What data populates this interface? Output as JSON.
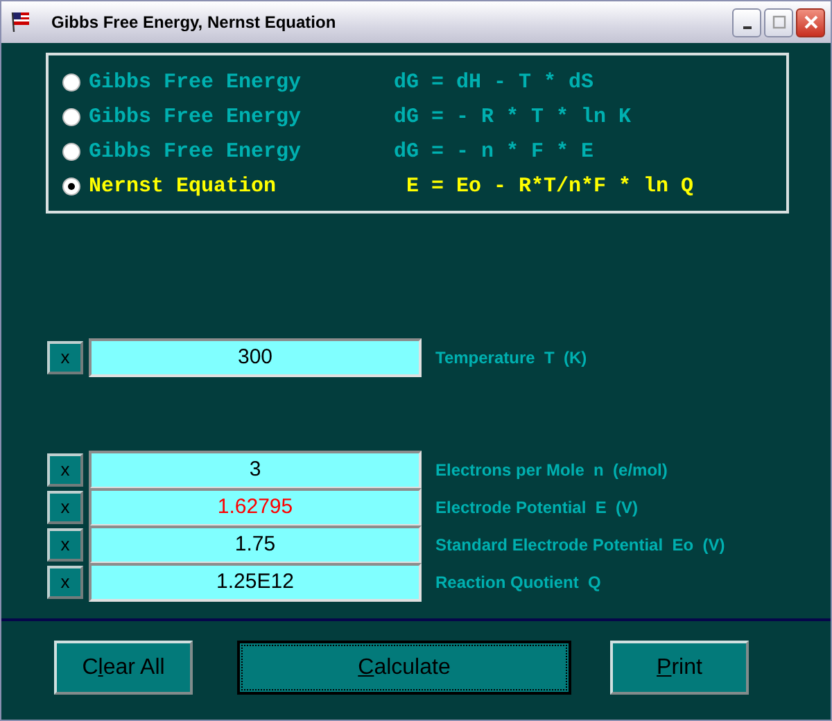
{
  "window": {
    "title": "Gibbs Free Energy, Nernst Equation"
  },
  "options": [
    {
      "label": "Gibbs Free Energy",
      "equation": "dG = dH - T * dS",
      "selected": false
    },
    {
      "label": "Gibbs Free Energy",
      "equation": "dG = - R * T * ln K",
      "selected": false
    },
    {
      "label": "Gibbs Free Energy",
      "equation": "dG = - n * F * E",
      "selected": false
    },
    {
      "label": "Nernst Equation",
      "equation": " E = Eo - R*T/n*F * ln Q",
      "selected": true
    }
  ],
  "field_groups": [
    [
      {
        "clear": "x",
        "value": "300",
        "label": "Temperature  T  (K)",
        "result": false
      }
    ],
    [
      {
        "clear": "x",
        "value": "3",
        "label": "Electrons per Mole  n  (e/mol)",
        "result": false
      },
      {
        "clear": "x",
        "value": "1.62795",
        "label": "Electrode Potential  E  (V)",
        "result": true
      },
      {
        "clear": "x",
        "value": "1.75",
        "label": "Standard Electrode Potential  Eo  (V)",
        "result": false
      },
      {
        "clear": "x",
        "value": "1.25E12",
        "label": "Reaction Quotient  Q",
        "result": false
      }
    ]
  ],
  "buttons": [
    {
      "label_start": "C",
      "mnemonic": "l",
      "label_rest": "ear All",
      "focused": false
    },
    {
      "mnemonic": "C",
      "label_rest": "alculate",
      "focused": true
    },
    {
      "mnemonic": "P",
      "label_rest": "rint",
      "focused": false
    }
  ]
}
